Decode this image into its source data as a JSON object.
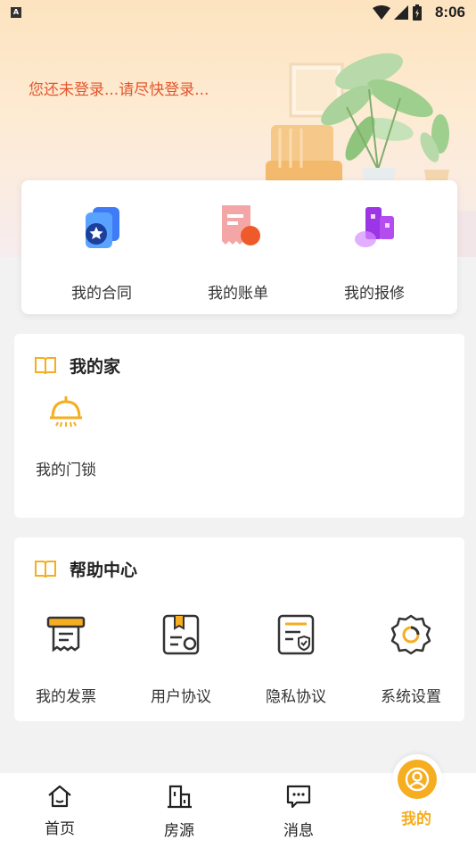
{
  "status_bar": {
    "time": "8:06",
    "badge": "A"
  },
  "header": {
    "login_hint": "您还未登录...请尽快登录..."
  },
  "quick_actions": [
    {
      "label": "我的合同",
      "icon": "contract-icon"
    },
    {
      "label": "我的账单",
      "icon": "bill-icon"
    },
    {
      "label": "我的报修",
      "icon": "repair-icon"
    }
  ],
  "my_home": {
    "title": "我的家",
    "items": [
      {
        "label": "我的门锁",
        "icon": "door-lock-icon"
      }
    ]
  },
  "help_center": {
    "title": "帮助中心",
    "items": [
      {
        "label": "我的发票",
        "icon": "invoice-icon"
      },
      {
        "label": "用户协议",
        "icon": "user-agreement-icon"
      },
      {
        "label": "隐私协议",
        "icon": "privacy-policy-icon"
      },
      {
        "label": "系统设置",
        "icon": "settings-icon"
      }
    ]
  },
  "bottom_nav": {
    "items": [
      {
        "label": "首页",
        "icon": "home-icon"
      },
      {
        "label": "房源",
        "icon": "building-icon"
      },
      {
        "label": "消息",
        "icon": "message-icon"
      },
      {
        "label": "我的",
        "icon": "profile-icon"
      }
    ],
    "active_index": 3
  },
  "colors": {
    "accent": "#f6ad1f",
    "hint": "#e4572e",
    "text": "#333333",
    "background": "#f2f2f2"
  }
}
